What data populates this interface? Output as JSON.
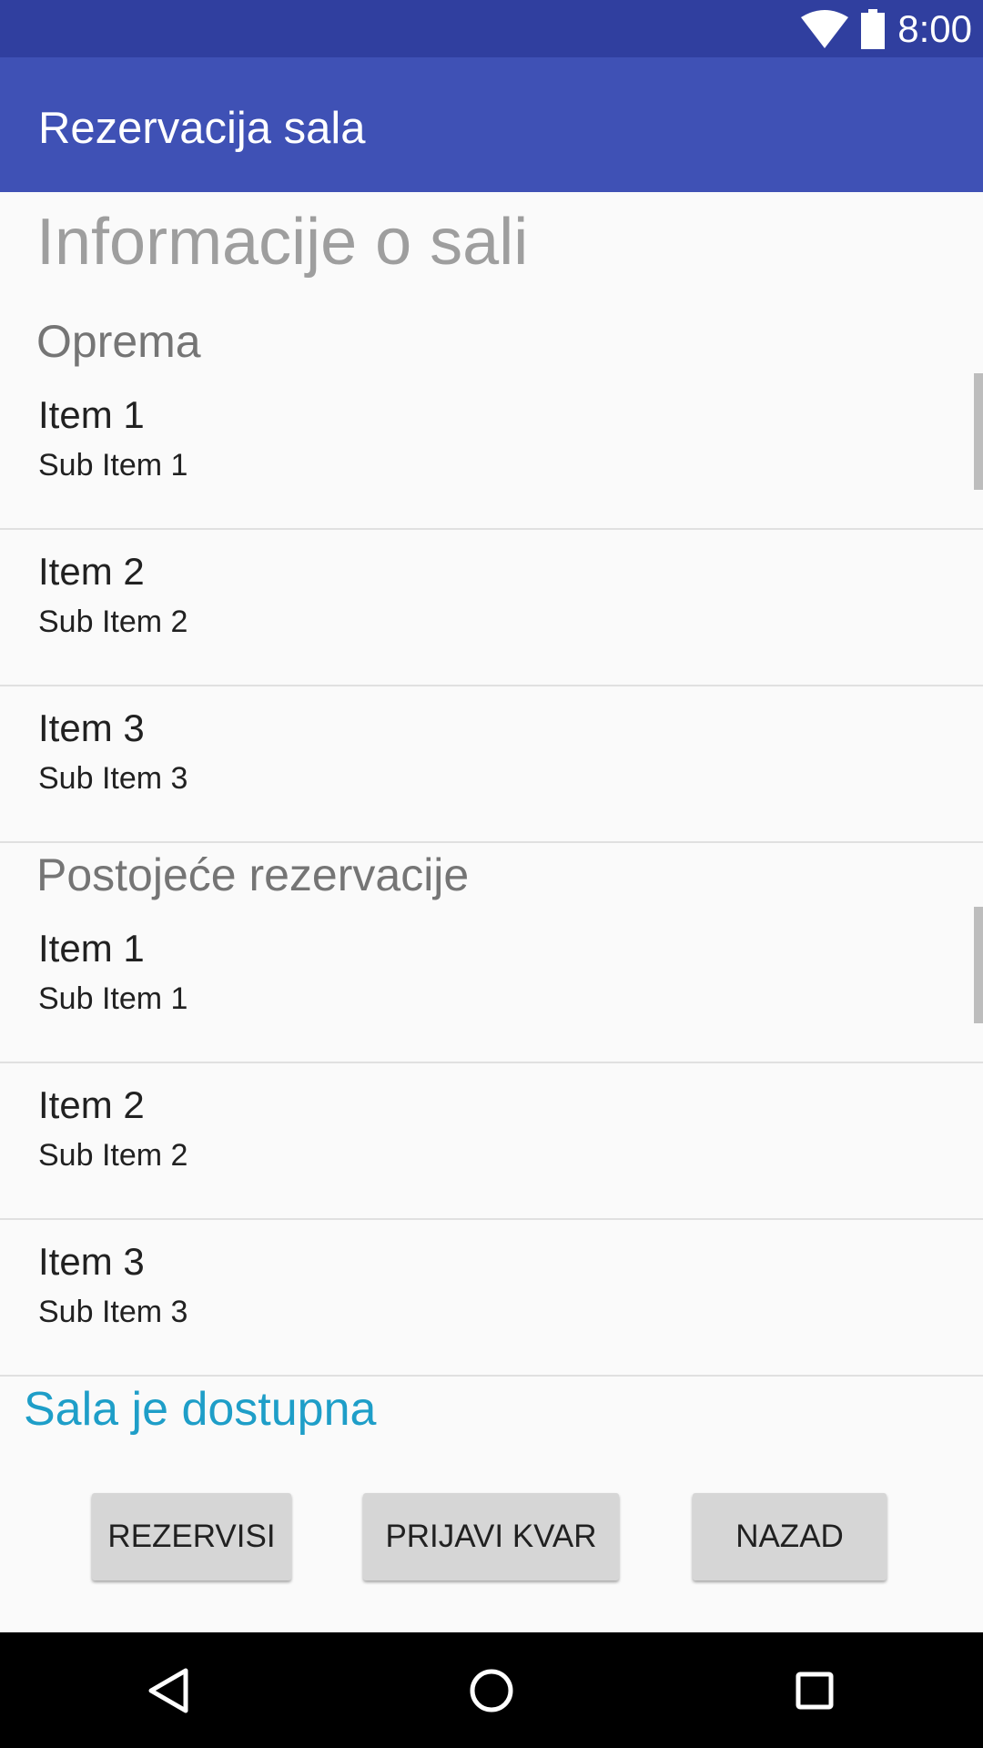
{
  "status_bar": {
    "time": "8:00",
    "icons": [
      "wifi-icon",
      "battery-icon"
    ]
  },
  "app_bar": {
    "title": "Rezervacija sala"
  },
  "page_title": "Informacije o sali",
  "equipment": {
    "title": "Oprema",
    "items": [
      {
        "title": "Item 1",
        "subtitle": "Sub Item 1"
      },
      {
        "title": "Item 2",
        "subtitle": "Sub Item 2"
      },
      {
        "title": "Item 3",
        "subtitle": "Sub Item 3"
      }
    ]
  },
  "reservations": {
    "title": "Postojeće rezervacije",
    "items": [
      {
        "title": "Item 1",
        "subtitle": "Sub Item 1"
      },
      {
        "title": "Item 2",
        "subtitle": "Sub Item 2"
      },
      {
        "title": "Item 3",
        "subtitle": "Sub Item 3"
      }
    ]
  },
  "availability_text": "Sala je dostupna",
  "buttons": {
    "reserve": "REZERVISI",
    "report": "PRIJAVI KVAR",
    "back": "NAZAD"
  },
  "nav_bar": {
    "icons": [
      "back-icon",
      "home-icon",
      "recents-icon"
    ]
  },
  "colors": {
    "status_bar": "#303f9f",
    "app_bar": "#3f51b5",
    "availability": "#1e9ec8",
    "button": "#d6d6d6"
  }
}
